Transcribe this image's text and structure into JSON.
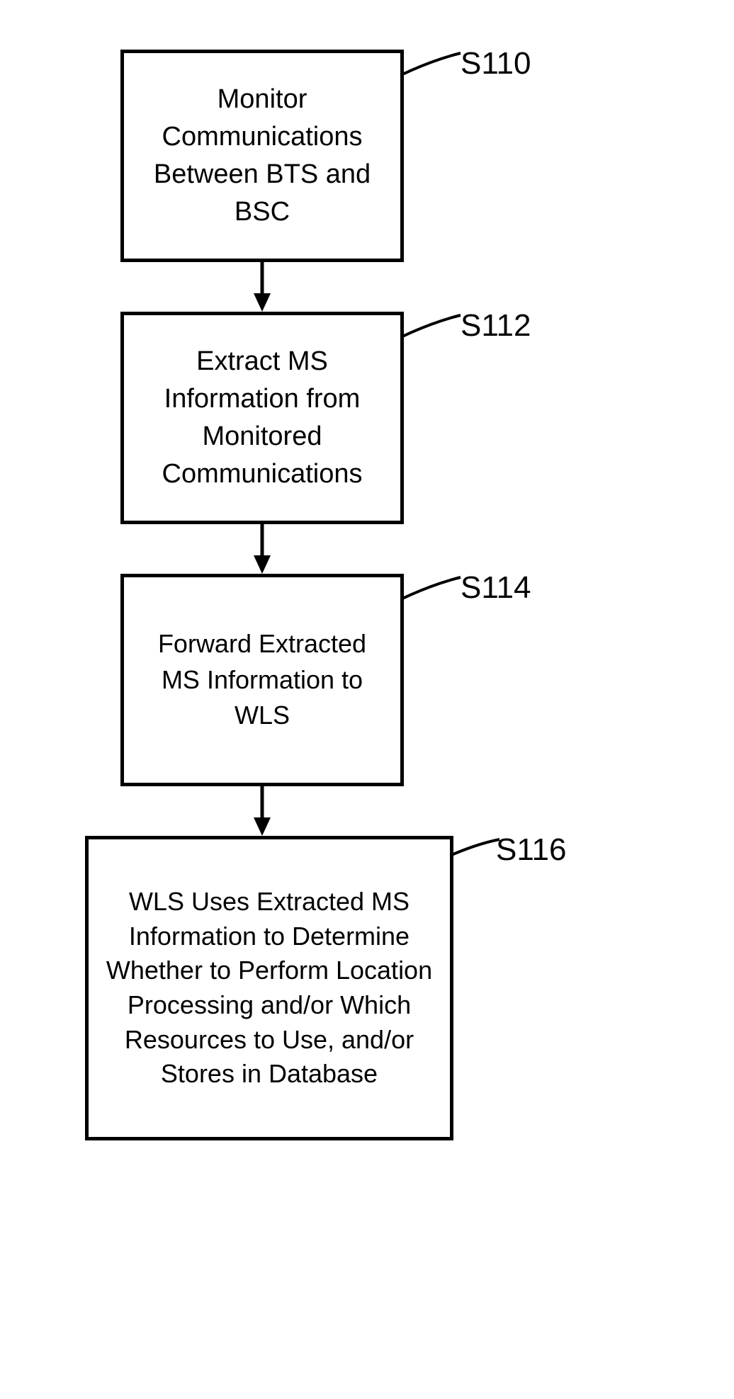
{
  "flowchart": {
    "steps": [
      {
        "id": "S110",
        "label": "S110",
        "text": "Monitor Communications Between BTS and BSC"
      },
      {
        "id": "S112",
        "label": "S112",
        "text": "Extract MS Information from Monitored Communications"
      },
      {
        "id": "S114",
        "label": "S114",
        "text": "Forward Extracted MS Information to WLS"
      },
      {
        "id": "S116",
        "label": "S116",
        "text": "WLS Uses Extracted MS Information to Determine Whether to Perform Location Processing and/or Which Resources to Use, and/or Stores in Database"
      }
    ]
  }
}
